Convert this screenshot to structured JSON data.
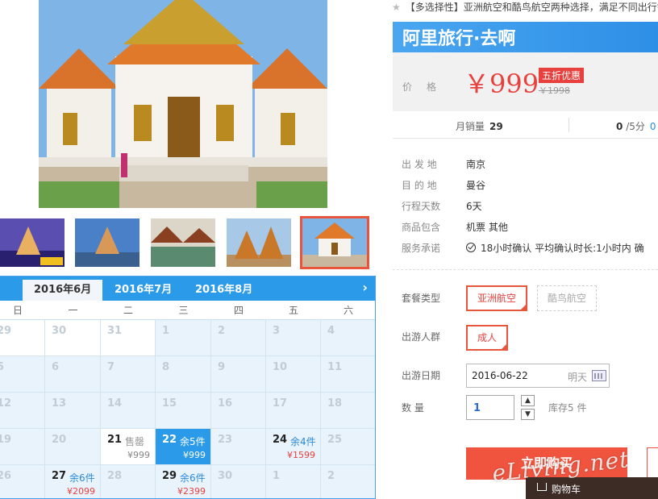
{
  "header": {
    "breadcrumb": "【多选择性】亚洲航空和酷鸟航空两种选择，满足不同出行需求",
    "brand": "阿里旅行·去啊"
  },
  "price": {
    "label": "价格",
    "current": "￥999",
    "badge": "五折优惠",
    "original": "￥1998"
  },
  "sales": {
    "label": "月销量",
    "value": "29",
    "rating": "0",
    "rating_suffix": "/5分",
    "extra": "0"
  },
  "info": [
    {
      "key": "出 发 地",
      "value": "南京"
    },
    {
      "key": "目 的 地",
      "value": "曼谷"
    },
    {
      "key": "行程天数",
      "value": "6天"
    },
    {
      "key": "商品包含",
      "value": "机票  其他"
    },
    {
      "key": "服务承诺",
      "value": "18小时确认   平均确认时长:1小时内   确"
    }
  ],
  "options": {
    "package_label": "套餐类型",
    "package_selected": "亚洲航空",
    "package_other": "酷鸟航空",
    "people_label": "出游人群",
    "people_selected": "成人",
    "date_label": "出游日期",
    "date_value": "2016-06-22",
    "date_tag": "明天",
    "qty_label": "数    量",
    "qty_value": "1",
    "stock": "库存5 件",
    "buy_label": "立即购买",
    "cart_label": "购物车",
    "qty_up": "▲",
    "qty_down": "▼"
  },
  "calendar": {
    "tabs": [
      "2016年6月",
      "2016年7月",
      "2016年8月"
    ],
    "next": "›",
    "weekdays": [
      "日",
      "一",
      "二",
      "三",
      "四",
      "五",
      "六"
    ],
    "rows": [
      [
        {
          "d": "29"
        },
        {
          "d": "30"
        },
        {
          "d": "31"
        },
        {
          "d": "1"
        },
        {
          "d": "2"
        },
        {
          "d": "3"
        },
        {
          "d": "4"
        }
      ],
      [
        {
          "d": "5"
        },
        {
          "d": "6"
        },
        {
          "d": "7"
        },
        {
          "d": "8"
        },
        {
          "d": "9"
        },
        {
          "d": "10"
        },
        {
          "d": "11"
        }
      ],
      [
        {
          "d": "12"
        },
        {
          "d": "13"
        },
        {
          "d": "14"
        },
        {
          "d": "15"
        },
        {
          "d": "16"
        },
        {
          "d": "17"
        },
        {
          "d": "18"
        }
      ],
      [
        {
          "d": "19"
        },
        {
          "d": "20"
        },
        {
          "d": "21",
          "s": "售罄",
          "p": "¥999",
          "soldout": true
        },
        {
          "d": "22",
          "s": "余5件",
          "p": "¥999",
          "sel": true
        },
        {
          "d": "23"
        },
        {
          "d": "24",
          "s": "余4件",
          "p": "¥1599"
        },
        {
          "d": "25"
        }
      ],
      [
        {
          "d": "26"
        },
        {
          "d": "27",
          "s": "余6件",
          "p": "¥2099"
        },
        {
          "d": "28"
        },
        {
          "d": "29",
          "s": "余6件",
          "p": "¥2399"
        },
        {
          "d": "30"
        },
        {
          "d": "1"
        },
        {
          "d": "2"
        }
      ]
    ]
  },
  "watermark": "eLiving.net",
  "colors": {
    "accent": "#2b9ae8",
    "price": "#e8413d",
    "buy": "#f0543f"
  }
}
